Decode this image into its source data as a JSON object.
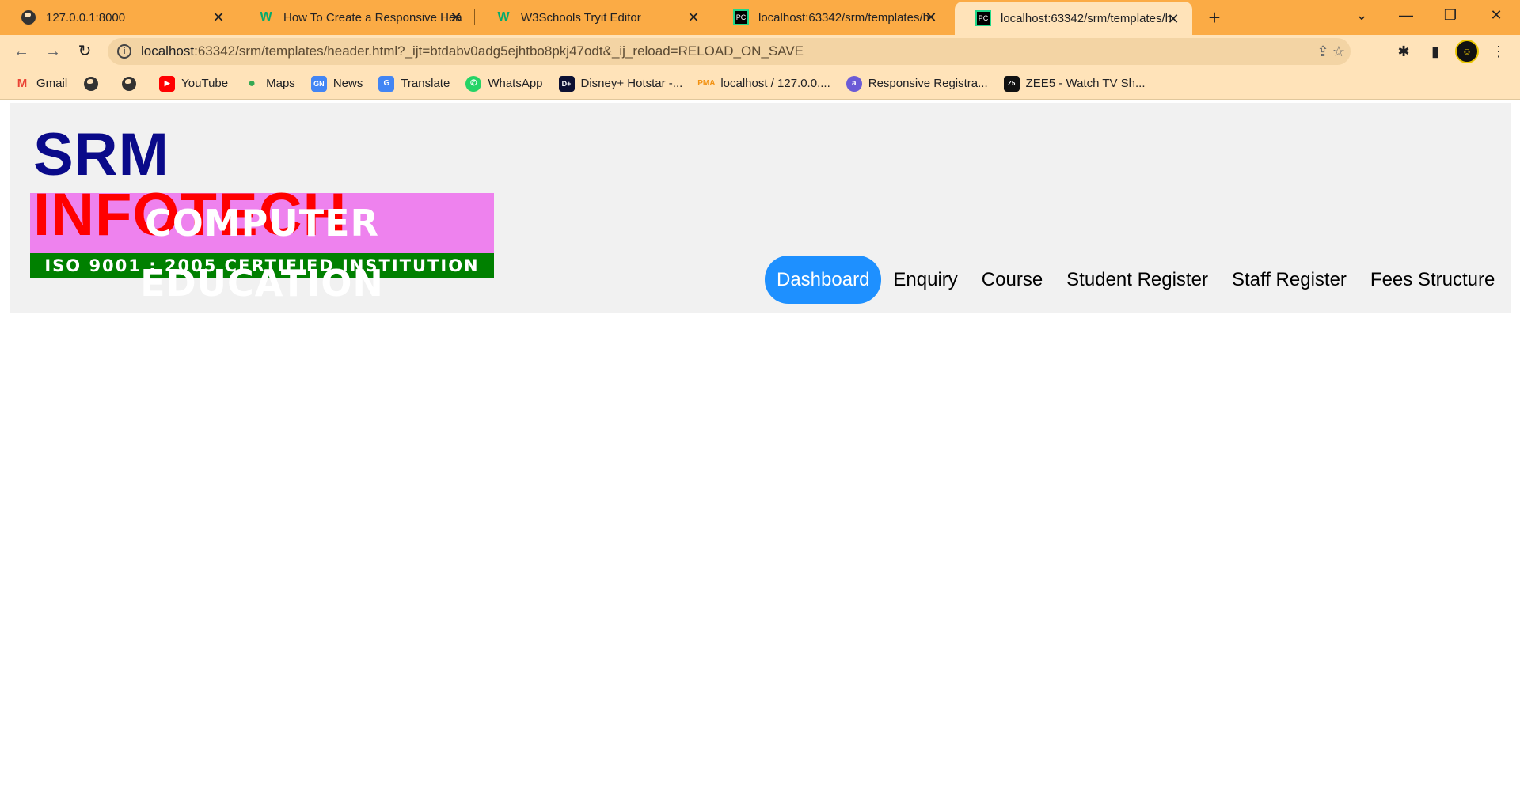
{
  "browser": {
    "tabs": [
      {
        "title": "127.0.0.1:8000",
        "icon": "globe-icon"
      },
      {
        "title": "How To Create a Responsive Hea",
        "icon": "w3schools-icon"
      },
      {
        "title": "W3Schools Tryit Editor",
        "icon": "w3schools-icon"
      },
      {
        "title": "localhost:63342/srm/templates/h",
        "icon": "pycharm-icon"
      },
      {
        "title": "localhost:63342/srm/templates/h",
        "icon": "pycharm-icon",
        "active": true
      }
    ],
    "close_glyph": "✕",
    "new_tab_glyph": "+",
    "url_host": "localhost",
    "url_rest": ":63342/srm/templates/header.html?_ijt=btdabv0adg5ejhtbo8pkj47odt&_ij_reload=RELOAD_ON_SAVE",
    "bookmarks": [
      {
        "label": "Gmail",
        "icon": "gmail-icon"
      },
      {
        "label": "",
        "icon": "globe-icon"
      },
      {
        "label": "",
        "icon": "globe-icon"
      },
      {
        "label": "YouTube",
        "icon": "youtube-icon"
      },
      {
        "label": "Maps",
        "icon": "maps-icon"
      },
      {
        "label": "News",
        "icon": "news-icon"
      },
      {
        "label": "Translate",
        "icon": "translate-icon"
      },
      {
        "label": "WhatsApp",
        "icon": "whatsapp-icon"
      },
      {
        "label": "Disney+ Hotstar -...",
        "icon": "hotstar-icon"
      },
      {
        "label": "localhost / 127.0.0....",
        "icon": "phpmyadmin-icon"
      },
      {
        "label": "Responsive Registra...",
        "icon": "registration-icon"
      },
      {
        "label": "ZEE5 - Watch TV Sh...",
        "icon": "zee5-icon"
      }
    ],
    "colors": {
      "tabstrip": "#fbab45",
      "toolbar": "#ffe3b9"
    }
  },
  "site": {
    "logo": {
      "word1": "SRM",
      "word2": "INFOTECH",
      "subtitle": "COMPUTER EDUCATION",
      "certification": "ISO 9001 : 2005 CERTIFIED INSTITUTION"
    },
    "nav": [
      {
        "label": "Dashboard",
        "active": true
      },
      {
        "label": "Enquiry"
      },
      {
        "label": "Course"
      },
      {
        "label": "Student Register"
      },
      {
        "label": "Staff Register"
      },
      {
        "label": "Fees Structure"
      }
    ],
    "colors": {
      "header_bg": "#f1f1f1",
      "nav_active": "#1e90ff",
      "logo_blue": "#0a0a8a",
      "logo_red": "#ff0000",
      "subtitle_bg": "#ee82ee",
      "cert_bg": "#008000"
    }
  }
}
